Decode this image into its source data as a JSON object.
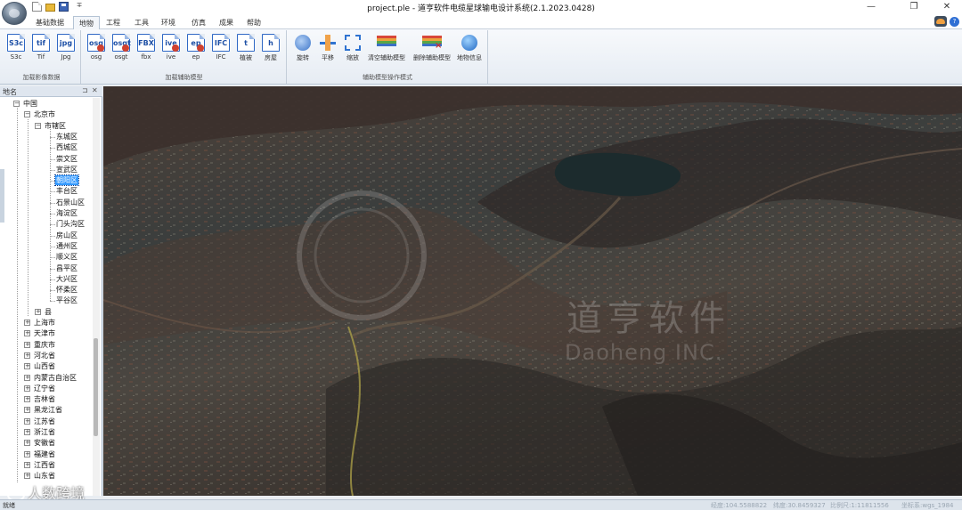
{
  "window": {
    "title": "project.ple - 道亨软件电缆星球输电设计系统(2.1.2023.0428)",
    "quick_access_menu": "∓",
    "min": "—",
    "max": "❐",
    "close": "✕"
  },
  "tabs": [
    "基础数据",
    "地物",
    "工程",
    "工具",
    "环境",
    "仿真",
    "成果",
    "帮助"
  ],
  "active_tab": "地物",
  "help_label": "?",
  "ribbon": {
    "groups": [
      {
        "label": "加载影像数据",
        "buttons": [
          {
            "icon_text": "S3c",
            "label": "S3c"
          },
          {
            "icon_text": "tif",
            "label": "Tif"
          },
          {
            "icon_text": "jpg",
            "label": "Jpg"
          }
        ]
      },
      {
        "label": "加载辅助模型",
        "buttons": [
          {
            "icon_text": "osg",
            "label": "osg"
          },
          {
            "icon_text": "osgt",
            "label": "osgt"
          },
          {
            "icon_text": "FBX",
            "label": "fbx"
          },
          {
            "icon_text": "ive",
            "label": "ive"
          },
          {
            "icon_text": "ep",
            "label": "ep"
          },
          {
            "icon_text": "IFC",
            "label": "IFC"
          },
          {
            "icon_text": "t",
            "label": "植被"
          },
          {
            "icon_text": "h",
            "label": "房屋"
          }
        ]
      },
      {
        "label": "辅助模型操作模式",
        "buttons": [
          {
            "icon": "rotate-icon",
            "label": "旋转"
          },
          {
            "icon": "pan-icon",
            "label": "平移"
          },
          {
            "icon": "zoom-icon",
            "label": "缩放"
          },
          {
            "icon": "clear-layers-icon",
            "label": "清空辅助模型"
          },
          {
            "icon": "delete-layer-icon",
            "label": "删除辅助模型"
          },
          {
            "icon": "feature-info-icon",
            "label": "地物信息"
          }
        ]
      }
    ]
  },
  "panel": {
    "title": "地名",
    "pin": "⊐",
    "close": "✕"
  },
  "tree": {
    "root": "中国",
    "city": "北京市",
    "district_group": "市辖区",
    "districts": [
      "东城区",
      "西城区",
      "崇文区",
      "宣武区",
      "朝阳区",
      "丰台区",
      "石景山区",
      "海淀区",
      "门头沟区",
      "房山区",
      "通州区",
      "顺义区",
      "昌平区",
      "大兴区",
      "怀柔区",
      "平谷区"
    ],
    "selected": "朝阳区",
    "county_group": "县",
    "provinces": [
      "上海市",
      "天津市",
      "重庆市",
      "河北省",
      "山西省",
      "内蒙古自治区",
      "辽宁省",
      "吉林省",
      "黑龙江省",
      "江苏省",
      "浙江省",
      "安徽省",
      "福建省",
      "江西省",
      "山东省"
    ]
  },
  "viewport": {
    "watermark_cn": "道亨软件",
    "watermark_en": "Daoheng INC.",
    "watermark_logo_text": "道亨"
  },
  "overlay": {
    "bottom_watermark": "人数跨境"
  },
  "statusbar": {
    "left": "就绪",
    "fields": [
      "经度:104.5588822",
      "纬度:30.8459327",
      "比例尺:1:11811556",
      "坐标系:wgs_1984"
    ]
  }
}
